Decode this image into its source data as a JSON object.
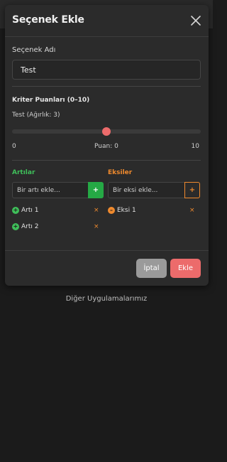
{
  "modal": {
    "title": "Seçenek Ekle",
    "close_icon": "close-icon"
  },
  "option": {
    "name_label": "Seçenek Adı",
    "name_value": "Test"
  },
  "criteria": {
    "title": "Kriter Puanları (0–10)",
    "items": [
      {
        "label": "Test (Ağırlık: 3)",
        "min": "0",
        "max": "10",
        "score_text": "Puan: 0",
        "value": 5,
        "range": [
          0,
          10
        ]
      }
    ]
  },
  "pros": {
    "title": "Artılar",
    "placeholder": "Bir artı ekle...",
    "add_label": "+",
    "items": [
      "Artı 1",
      "Artı 2"
    ],
    "color": "#3fbf5a"
  },
  "cons": {
    "title": "Eksiler",
    "placeholder": "Bir eksi ekle...",
    "add_label": "+",
    "items": [
      "Eksi 1"
    ],
    "color": "#ef8a2e"
  },
  "remove_label": "×",
  "item_icons": {
    "pro": "+",
    "con": "–"
  },
  "footer": {
    "cancel_label": "İptal",
    "submit_label": "Ekle"
  },
  "background": {
    "link_text": "Diğer Uygulamalarımız"
  },
  "colors": {
    "accent": "#ec6b6b",
    "pro": "#3fbf5a",
    "con": "#ef8a2e",
    "modal_bg": "#2b2b2b"
  }
}
